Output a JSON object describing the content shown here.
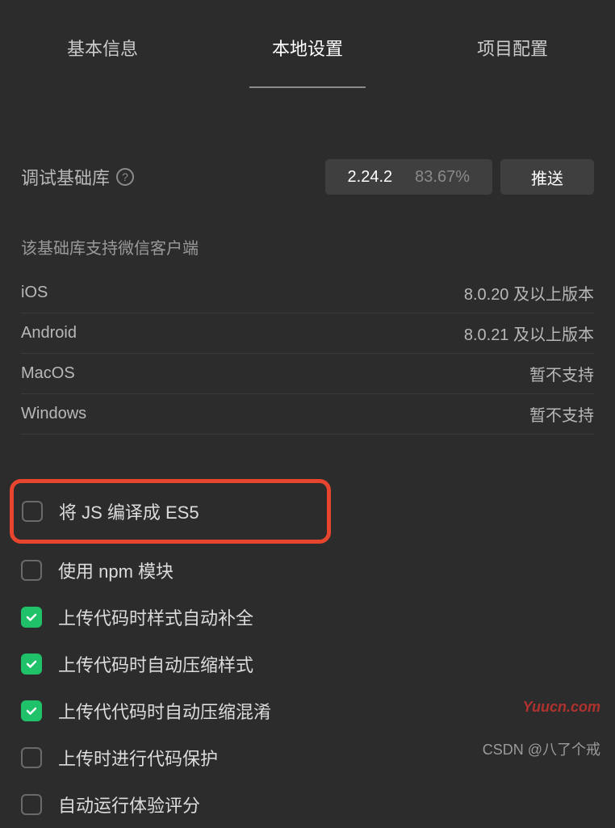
{
  "tabs": {
    "basic": "基本信息",
    "local": "本地设置",
    "project": "项目配置"
  },
  "debug": {
    "label": "调试基础库",
    "version": "2.24.2",
    "percent": "83.67%",
    "push": "推送"
  },
  "support": {
    "note": "该基础库支持微信客户端",
    "rows": [
      {
        "platform": "iOS",
        "value": "8.0.20 及以上版本"
      },
      {
        "platform": "Android",
        "value": "8.0.21 及以上版本"
      },
      {
        "platform": "MacOS",
        "value": "暂不支持"
      },
      {
        "platform": "Windows",
        "value": "暂不支持"
      }
    ]
  },
  "options": [
    {
      "label": "将 JS 编译成 ES5",
      "checked": false,
      "highlighted": true
    },
    {
      "label": "使用 npm 模块",
      "checked": false
    },
    {
      "label": "上传代码时样式自动补全",
      "checked": true
    },
    {
      "label": "上传代码时自动压缩样式",
      "checked": true
    },
    {
      "label": "上传代代码时自动压缩混淆",
      "checked": true
    },
    {
      "label": "上传时进行代码保护",
      "checked": false
    },
    {
      "label": "自动运行体验评分",
      "checked": false
    }
  ],
  "watermark": {
    "site": "Yuucn.com",
    "author": "CSDN @八了个戒"
  }
}
